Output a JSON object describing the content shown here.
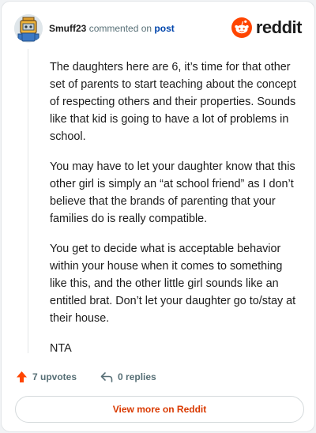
{
  "header": {
    "username": "Smuff23",
    "commented_text": "commented on",
    "post_link_text": "post",
    "brand_word": "reddit"
  },
  "comment": {
    "paragraphs": [
      "The daughters here are 6, it’s time for that other set of parents to start teaching about the concept of respecting others and their properties. Sounds like that kid is going to have a lot of problems in school.",
      "You may have to let your daughter know that this other girl is simply an “at school friend” as I don’t believe that the brands of parenting that your families do is really compatible.",
      "You get to decide what is acceptable behavior within your house when it comes to something like this, and the other little girl sounds like an entitled brat. Don’t let your daughter go to/stay at their house.",
      "NTA"
    ]
  },
  "actions": {
    "upvotes_label": "7 upvotes",
    "replies_label": "0 replies"
  },
  "footer": {
    "view_more_label": "View more on Reddit"
  },
  "colors": {
    "accent": "#ff4500",
    "link": "#0045ac",
    "view_more": "#d93900"
  },
  "icons": {
    "avatar": "robot-avatar",
    "brand": "reddit-snoo-logo",
    "upvote": "upvote-arrow-icon",
    "reply": "reply-arrow-icon"
  }
}
